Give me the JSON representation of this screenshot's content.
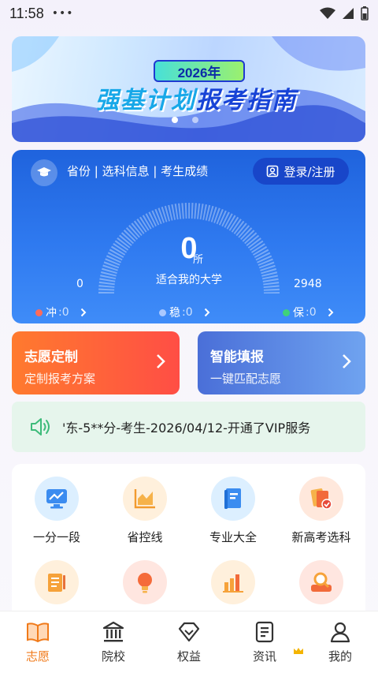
{
  "status_bar": {
    "time": "11:58",
    "dots": "•••"
  },
  "banner": {
    "year": "2026年",
    "title_part1": "强基计划",
    "title_part2": "报考指南",
    "slides": 2,
    "active_slide": 1
  },
  "score_card": {
    "info_text": "省份 | 选科信息 | 考生成绩",
    "login_label": "登录/注册",
    "count": "0",
    "unit": "所",
    "caption": "适合我的大学",
    "min": "0",
    "max": "2948",
    "tiers": [
      {
        "label": "冲",
        "count": ":0",
        "color": "#ff6b5a"
      },
      {
        "label": "稳",
        "count": ":0",
        "color": "#a9c8ff"
      },
      {
        "label": "保",
        "count": ":0",
        "color": "#3fd27a"
      }
    ]
  },
  "features": {
    "custom": {
      "title": "志愿定制",
      "subtitle": "定制报考方案"
    },
    "smart": {
      "title": "智能填报",
      "subtitle": "一键匹配志愿"
    }
  },
  "marquee": {
    "text": "'东-5**分-考生-2026/04/12-开通了VIP服务"
  },
  "tools": [
    {
      "label": "一分一段",
      "icon": "monitor-chart-icon"
    },
    {
      "label": "省控线",
      "icon": "area-chart-icon"
    },
    {
      "label": "专业大全",
      "icon": "book-icon"
    },
    {
      "label": "新高考选科",
      "icon": "cards-check-icon"
    },
    {
      "label": "",
      "icon": "notepad-icon"
    },
    {
      "label": "",
      "icon": "lightbulb-icon"
    },
    {
      "label": "",
      "icon": "bar-chart-icon"
    },
    {
      "label": "",
      "icon": "search-person-icon"
    }
  ],
  "nav": [
    {
      "label": "志愿",
      "icon": "open-book-icon",
      "active": true
    },
    {
      "label": "院校",
      "icon": "building-icon",
      "active": false
    },
    {
      "label": "权益",
      "icon": "diamond-icon",
      "active": false
    },
    {
      "label": "资讯",
      "icon": "news-icon",
      "active": false
    },
    {
      "label": "我的",
      "icon": "person-icon",
      "active": false
    }
  ],
  "colors": {
    "accent": "#f07a1a",
    "card_blue": "#1f63dd",
    "orange_card": "#ff6a38",
    "blue_card": "#5a88e4"
  }
}
